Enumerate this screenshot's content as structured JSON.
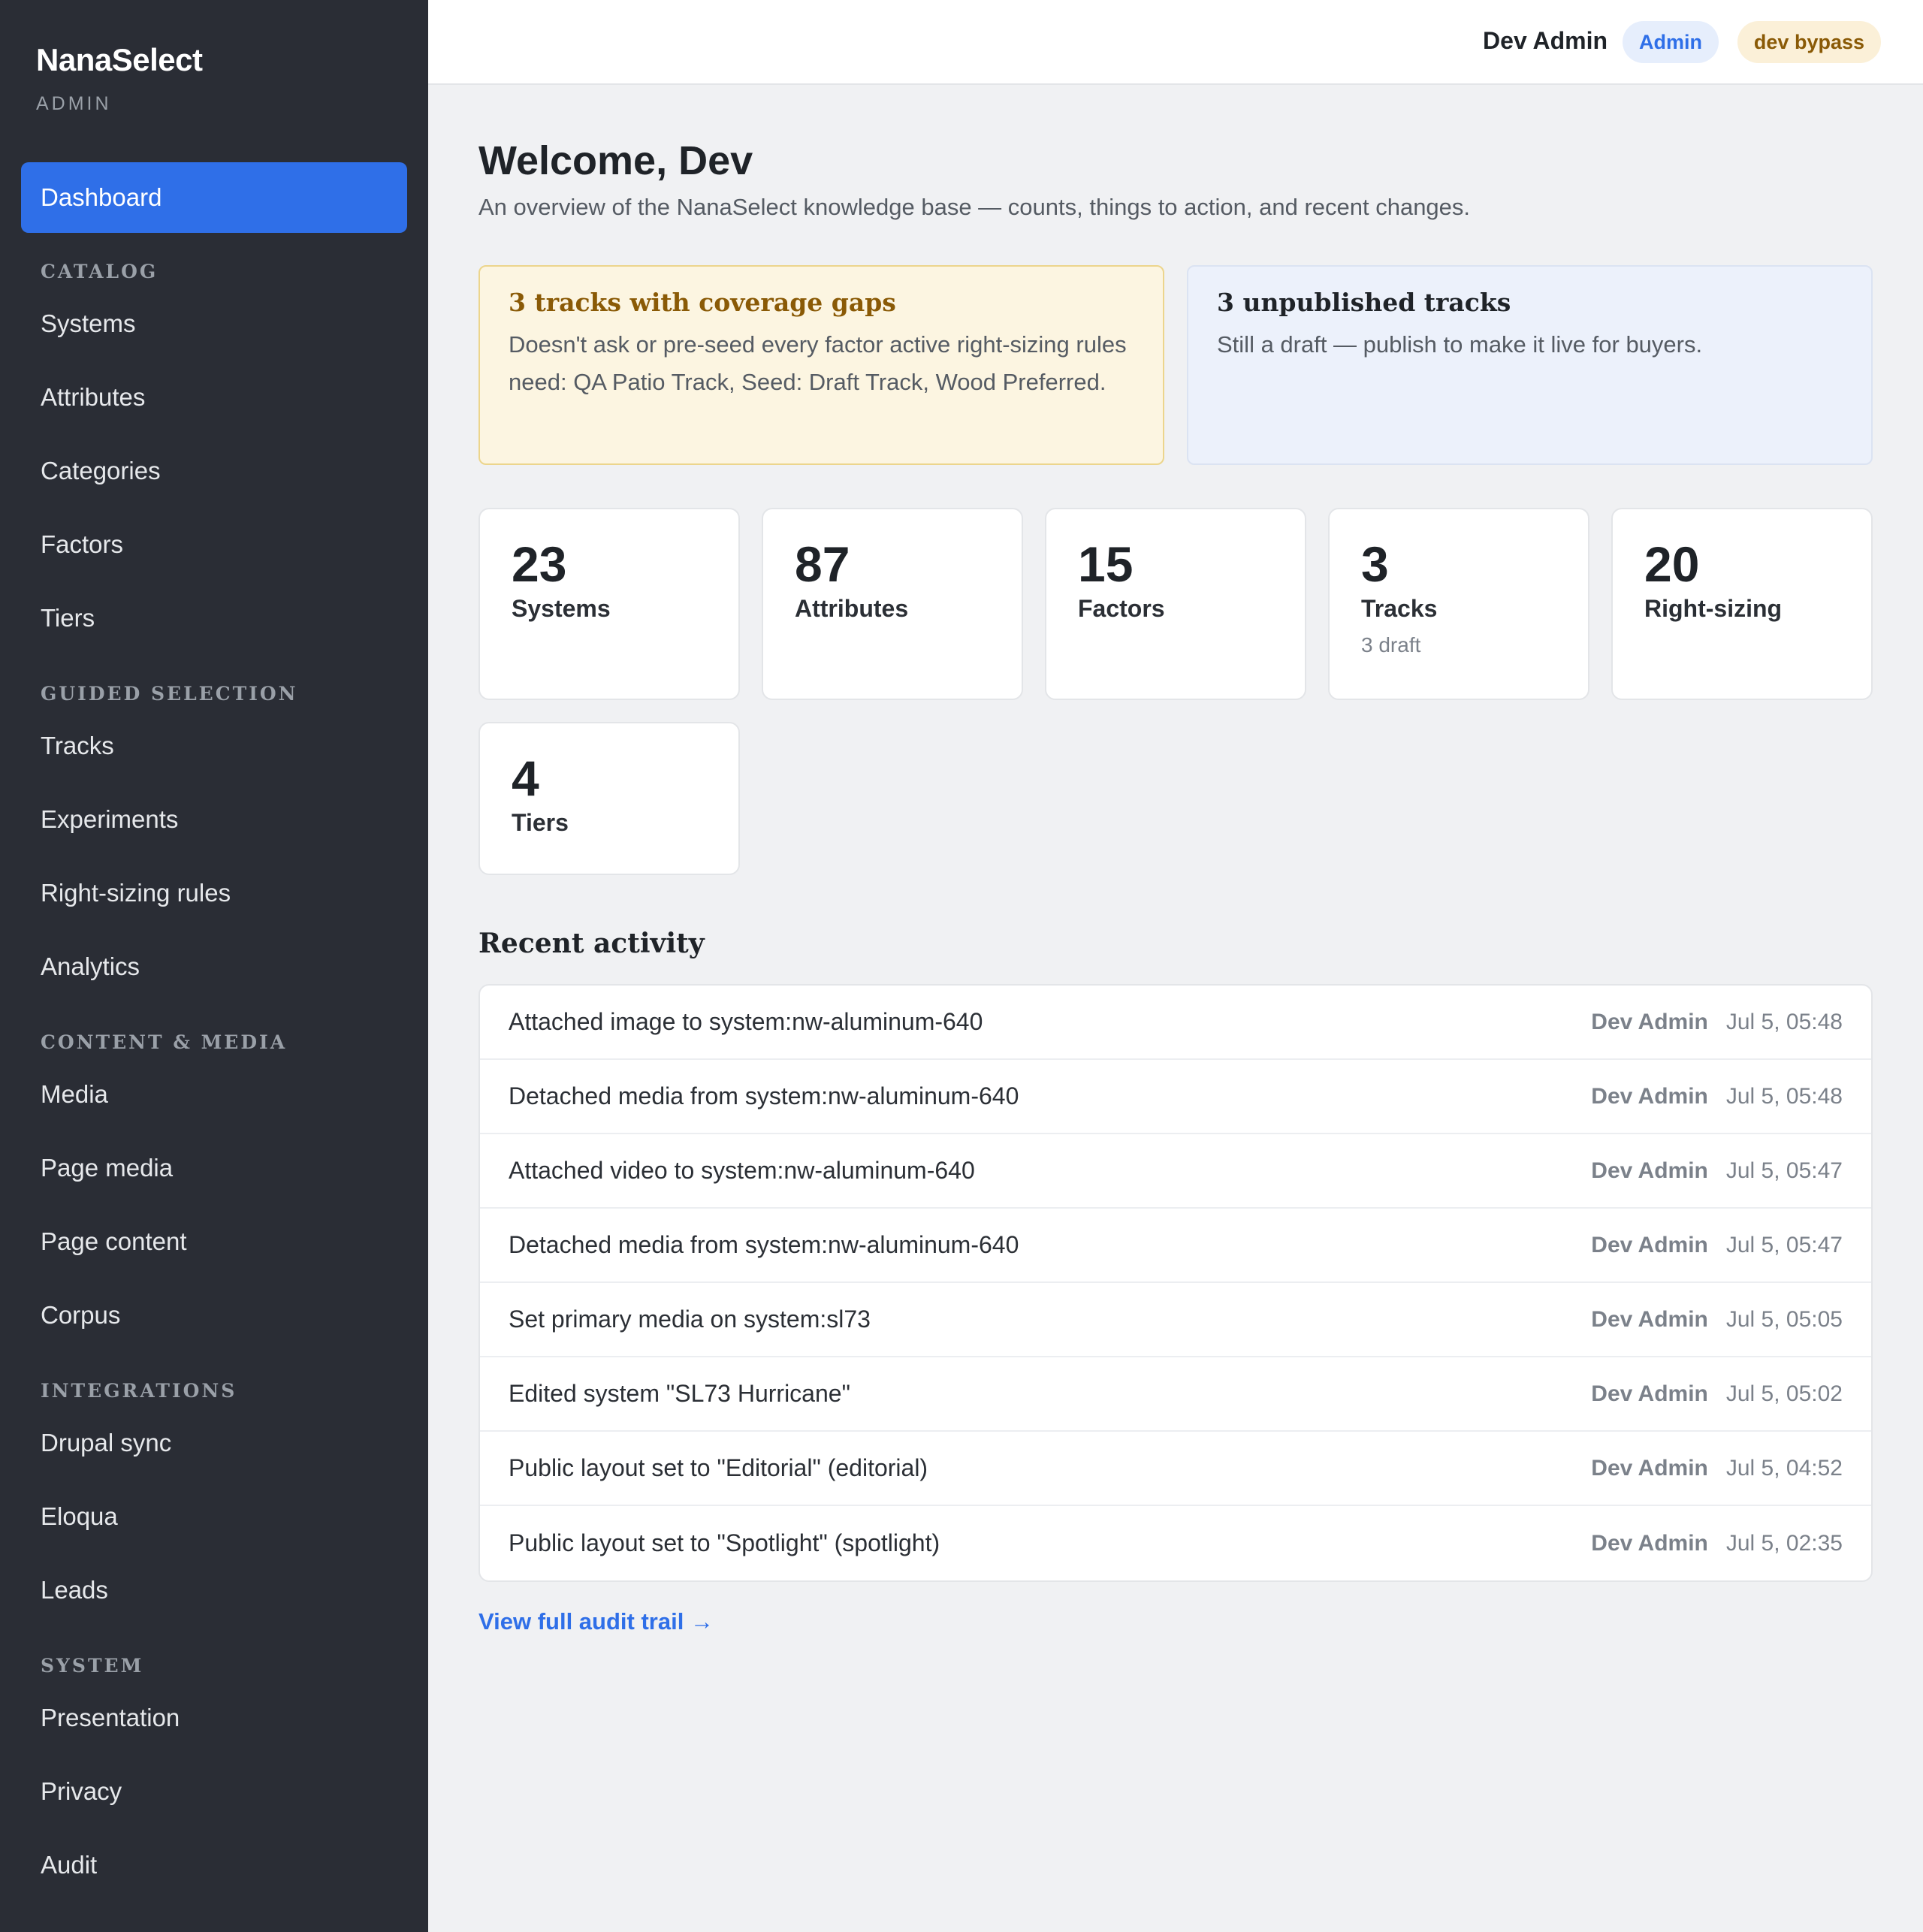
{
  "brand": {
    "name": "NanaSelect",
    "subtitle": "ADMIN"
  },
  "topbar": {
    "user": "Dev Admin",
    "role_badge": "Admin",
    "mode_badge": "dev bypass"
  },
  "sidebar": {
    "active": "Dashboard",
    "items": [
      {
        "type": "item",
        "label": "Dashboard"
      },
      {
        "type": "section",
        "label": "CATALOG"
      },
      {
        "type": "item",
        "label": "Systems"
      },
      {
        "type": "item",
        "label": "Attributes"
      },
      {
        "type": "item",
        "label": "Categories"
      },
      {
        "type": "item",
        "label": "Factors"
      },
      {
        "type": "item",
        "label": "Tiers"
      },
      {
        "type": "section",
        "label": "GUIDED SELECTION"
      },
      {
        "type": "item",
        "label": "Tracks"
      },
      {
        "type": "item",
        "label": "Experiments"
      },
      {
        "type": "item",
        "label": "Right-sizing rules"
      },
      {
        "type": "item",
        "label": "Analytics"
      },
      {
        "type": "section",
        "label": "CONTENT & MEDIA"
      },
      {
        "type": "item",
        "label": "Media"
      },
      {
        "type": "item",
        "label": "Page media"
      },
      {
        "type": "item",
        "label": "Page content"
      },
      {
        "type": "item",
        "label": "Corpus"
      },
      {
        "type": "section",
        "label": "INTEGRATIONS"
      },
      {
        "type": "item",
        "label": "Drupal sync"
      },
      {
        "type": "item",
        "label": "Eloqua"
      },
      {
        "type": "item",
        "label": "Leads"
      },
      {
        "type": "section",
        "label": "SYSTEM"
      },
      {
        "type": "item",
        "label": "Presentation"
      },
      {
        "type": "item",
        "label": "Privacy"
      },
      {
        "type": "item",
        "label": "Audit"
      }
    ]
  },
  "main": {
    "title": "Welcome, Dev",
    "subtitle": "An overview of the NanaSelect knowledge base — counts, things to action, and recent changes.",
    "alerts": {
      "coverage": {
        "title": "3 tracks with coverage gaps",
        "body": "Doesn't ask or pre-seed every factor active right-sizing rules need: QA Patio Track, Seed: Draft Track, Wood Preferred."
      },
      "unpublished": {
        "title": "3 unpublished tracks",
        "body": "Still a draft — publish to make it live for buyers."
      }
    },
    "stats": [
      {
        "value": "23",
        "label": "Systems",
        "note": ""
      },
      {
        "value": "87",
        "label": "Attributes",
        "note": ""
      },
      {
        "value": "15",
        "label": "Factors",
        "note": ""
      },
      {
        "value": "3",
        "label": "Tracks",
        "note": "3 draft"
      },
      {
        "value": "20",
        "label": "Right-sizing",
        "note": ""
      },
      {
        "value": "4",
        "label": "Tiers",
        "note": ""
      }
    ],
    "activity_title": "Recent activity",
    "activity": [
      {
        "text": "Attached image to system:nw-aluminum-640",
        "user": "Dev Admin",
        "time": "Jul 5, 05:48"
      },
      {
        "text": "Detached media from system:nw-aluminum-640",
        "user": "Dev Admin",
        "time": "Jul 5, 05:48"
      },
      {
        "text": "Attached video to system:nw-aluminum-640",
        "user": "Dev Admin",
        "time": "Jul 5, 05:47"
      },
      {
        "text": "Detached media from system:nw-aluminum-640",
        "user": "Dev Admin",
        "time": "Jul 5, 05:47"
      },
      {
        "text": "Set primary media on system:sl73",
        "user": "Dev Admin",
        "time": "Jul 5, 05:05"
      },
      {
        "text": "Edited system \"SL73 Hurricane\"",
        "user": "Dev Admin",
        "time": "Jul 5, 05:02"
      },
      {
        "text": "Public layout set to \"Editorial\" (editorial)",
        "user": "Dev Admin",
        "time": "Jul 5, 04:52"
      },
      {
        "text": "Public layout set to \"Spotlight\" (spotlight)",
        "user": "Dev Admin",
        "time": "Jul 5, 02:35"
      }
    ],
    "audit_link": "View full audit trail →"
  },
  "colors": {
    "accent": "#2f6fe8",
    "sidebar_bg": "#2a2d35",
    "warn_bg": "#fcf5e1",
    "info_bg": "#ecf1fb"
  }
}
